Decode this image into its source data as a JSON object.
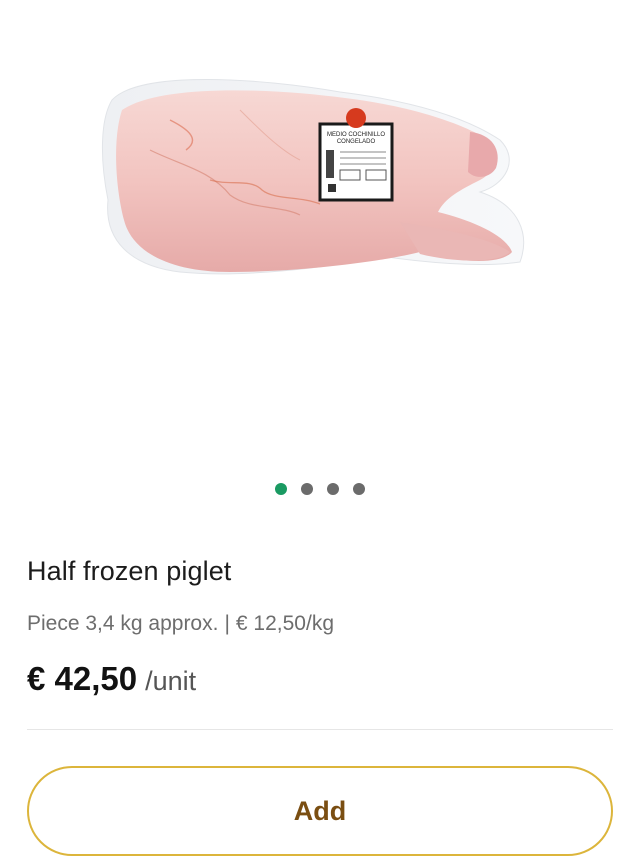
{
  "product": {
    "title": "Half frozen piglet",
    "piece_info": "Piece 3,4 kg approx.",
    "separator": "|",
    "price_per_kg": "€ 12,50/kg",
    "price": "€ 42,50",
    "unit": "/unit"
  },
  "image": {
    "label_line1": "MEDIO COCHINILLO",
    "label_line2": "CONGELADO"
  },
  "carousel": {
    "count": 4,
    "active_index": 0,
    "active_color": "#1a9a62",
    "inactive_color": "#6b6b6b"
  },
  "actions": {
    "add_label": "Add",
    "accent_color": "#dcb53b"
  }
}
